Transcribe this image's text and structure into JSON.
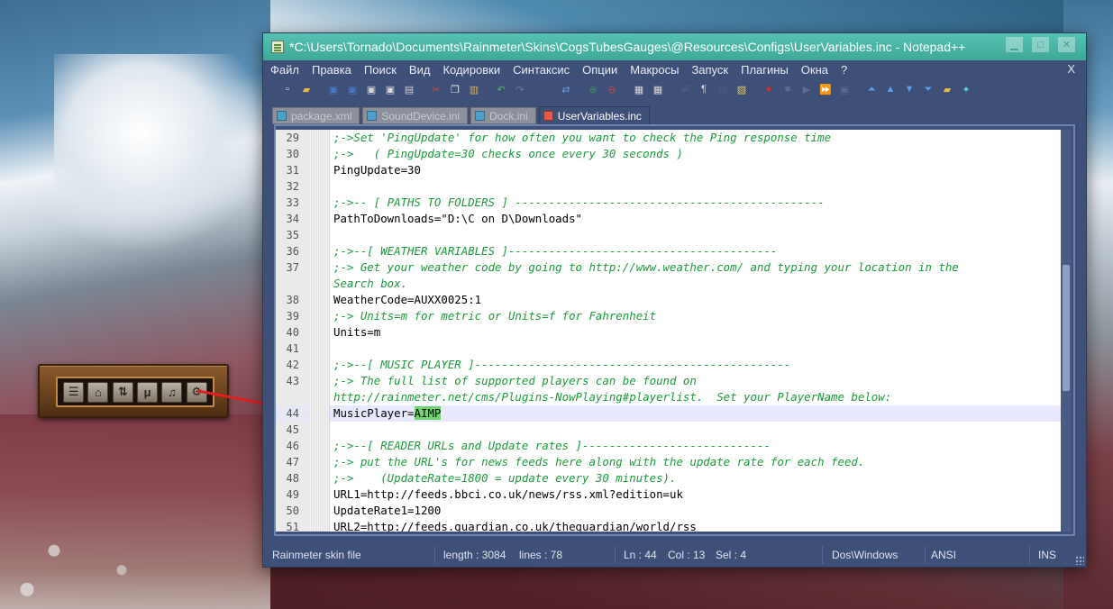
{
  "window": {
    "title": "*C:\\Users\\Tornado\\Documents\\Rainmeter\\Skins\\CogsTubesGauges\\@Resources\\Configs\\UserVariables.inc - Notepad++",
    "minimize_label": "▁",
    "maximize_label": "□",
    "close_label": "✕"
  },
  "menu": {
    "items": [
      "Файл",
      "Правка",
      "Поиск",
      "Вид",
      "Кодировки",
      "Синтаксис",
      "Опции",
      "Макросы",
      "Запуск",
      "Плагины",
      "Окна",
      "?"
    ],
    "close_label": "X"
  },
  "toolbar": {
    "buttons": [
      {
        "name": "new-file-icon",
        "glyph": "▫",
        "color": "#f2f2f2"
      },
      {
        "name": "open-file-icon",
        "glyph": "▰",
        "color": "#e7b94a"
      },
      {
        "name": "save-icon",
        "glyph": "▣",
        "color": "#4a78c8"
      },
      {
        "name": "save-all-icon",
        "glyph": "▣",
        "color": "#4a78c8"
      },
      {
        "name": "close-file-icon",
        "glyph": "▣",
        "color": "#d8d8d8"
      },
      {
        "name": "close-all-icon",
        "glyph": "▣",
        "color": "#d8d8d8"
      },
      {
        "name": "print-icon",
        "glyph": "▤",
        "color": "#cfcfcf"
      },
      {
        "name": "cut-icon",
        "glyph": "✂",
        "color": "#d24a3a"
      },
      {
        "name": "copy-icon",
        "glyph": "❐",
        "color": "#e8e8e8"
      },
      {
        "name": "paste-icon",
        "glyph": "▥",
        "color": "#d8b060"
      },
      {
        "name": "undo-icon",
        "glyph": "↶",
        "color": "#4ab86a"
      },
      {
        "name": "redo-icon",
        "glyph": "↷",
        "color": "#6a7a9a"
      },
      {
        "name": "find-icon",
        "glyph": "⌕",
        "color": "#3e4f78"
      },
      {
        "name": "replace-icon",
        "glyph": "⇄",
        "color": "#6aa0e0"
      },
      {
        "name": "zoom-in-icon",
        "glyph": "⊕",
        "color": "#3e8e5a"
      },
      {
        "name": "zoom-out-icon",
        "glyph": "⊖",
        "color": "#c84a4a"
      },
      {
        "name": "sync-vertical-icon",
        "glyph": "▦",
        "color": "#d8d8d8"
      },
      {
        "name": "sync-horizontal-icon",
        "glyph": "▦",
        "color": "#d8d8d8"
      },
      {
        "name": "word-wrap-icon",
        "glyph": "⏎",
        "color": "#5a6a90"
      },
      {
        "name": "show-all-chars-icon",
        "glyph": "¶",
        "color": "#cfd6e8"
      },
      {
        "name": "indent-guide-icon",
        "glyph": "▤",
        "color": "#4a5a80"
      },
      {
        "name": "doc-map-icon",
        "glyph": "▧",
        "color": "#e7c85a"
      },
      {
        "name": "record-macro-icon",
        "glyph": "●",
        "color": "#d82a2a"
      },
      {
        "name": "stop-macro-icon",
        "glyph": "■",
        "color": "#5a6a90"
      },
      {
        "name": "play-macro-icon",
        "glyph": "▶",
        "color": "#5a6a90"
      },
      {
        "name": "run-macro-multiple-icon",
        "glyph": "⏩",
        "color": "#5a7ad8"
      },
      {
        "name": "save-macro-icon",
        "glyph": "▣",
        "color": "#5a6a90"
      },
      {
        "name": "move-top-icon",
        "glyph": "⏶",
        "color": "#5aa0e8"
      },
      {
        "name": "move-up-icon",
        "glyph": "▲",
        "color": "#5aa0e8"
      },
      {
        "name": "move-down-icon",
        "glyph": "▼",
        "color": "#5aa0e8"
      },
      {
        "name": "move-bottom-icon",
        "glyph": "⏷",
        "color": "#5aa0e8"
      },
      {
        "name": "folder-icon",
        "glyph": "▰",
        "color": "#e7b94a"
      },
      {
        "name": "plugin-icon",
        "glyph": "✦",
        "color": "#5ad0c8"
      }
    ]
  },
  "tabs": [
    {
      "label": "package.xml",
      "active": false
    },
    {
      "label": "SoundDevice.ini",
      "active": false
    },
    {
      "label": "Dock.ini",
      "active": false
    },
    {
      "label": "UserVariables.inc",
      "active": true
    }
  ],
  "editor": {
    "lines": [
      {
        "num": "29",
        "text": ";->Set 'PingUpdate' for how often you want to check the Ping response time",
        "comment": true
      },
      {
        "num": "30",
        "text": ";->   ( PingUpdate=30 checks once every 30 seconds )",
        "comment": true
      },
      {
        "num": "31",
        "text": "PingUpdate=30",
        "comment": false
      },
      {
        "num": "32",
        "text": "",
        "comment": false
      },
      {
        "num": "33",
        "text": ";->-- [ PATHS TO FOLDERS ] ----------------------------------------------",
        "comment": true
      },
      {
        "num": "34",
        "text": "PathToDownloads=\"D:\\C on D\\Downloads\"",
        "comment": false
      },
      {
        "num": "35",
        "text": "",
        "comment": false
      },
      {
        "num": "36",
        "text": ";->--[ WEATHER VARIABLES ]----------------------------------------",
        "comment": true
      },
      {
        "num": "37",
        "text": ";-> Get your weather code by going to http://www.weather.com/ and typing your location in the",
        "comment": true
      },
      {
        "num": "",
        "text": "Search box.",
        "comment": true
      },
      {
        "num": "38",
        "text": "WeatherCode=AUXX0025:1",
        "comment": false
      },
      {
        "num": "39",
        "text": ";-> Units=m for metric or Units=f for Fahrenheit",
        "comment": true
      },
      {
        "num": "40",
        "text": "Units=m",
        "comment": false
      },
      {
        "num": "41",
        "text": "",
        "comment": false
      },
      {
        "num": "42",
        "text": ";->--[ MUSIC PLAYER ]-----------------------------------------------",
        "comment": true
      },
      {
        "num": "43",
        "text": ";-> The full list of supported players can be found on",
        "comment": true
      },
      {
        "num": "",
        "text": "http://rainmeter.net/cms/Plugins-NowPlaying#playerlist.  Set your PlayerName below:",
        "comment": true
      },
      {
        "num": "44",
        "text": "MusicPlayer=",
        "comment": false,
        "current": true,
        "selected": "AIMP"
      },
      {
        "num": "45",
        "text": "",
        "comment": false
      },
      {
        "num": "46",
        "text": ";->--[ READER URLs and Update rates ]----------------------------",
        "comment": true
      },
      {
        "num": "47",
        "text": ";-> put the URL's for news feeds here along with the update rate for each feed.",
        "comment": true
      },
      {
        "num": "48",
        "text": ";->    (UpdateRate=1800 = update every 30 minutes).",
        "comment": true
      },
      {
        "num": "49",
        "text": "URL1=http://feeds.bbci.co.uk/news/rss.xml?edition=uk",
        "comment": false
      },
      {
        "num": "50",
        "text": "UpdateRate1=1200",
        "comment": false
      },
      {
        "num": "51",
        "text": "URL2=http://feeds.guardian.co.uk/theguardian/world/rss",
        "comment": false
      }
    ]
  },
  "status": {
    "file_type": "Rainmeter skin file",
    "length": "length : 3084",
    "lines": "lines : 78",
    "ln": "Ln : 44",
    "col": "Col : 13",
    "sel": "Sel : 4",
    "eol": "Dos\\Windows",
    "encoding": "ANSI",
    "mode": "INS"
  },
  "widget": {
    "buttons": [
      {
        "name": "rss-icon",
        "glyph": "☰"
      },
      {
        "name": "network-icon",
        "glyph": "⌂"
      },
      {
        "name": "dock-settings-icon",
        "glyph": "⇅"
      },
      {
        "name": "text-icon",
        "glyph": "μ"
      },
      {
        "name": "music-icon",
        "glyph": "♫"
      },
      {
        "name": "gear-icon",
        "glyph": "⚙"
      }
    ]
  },
  "colors": {
    "titlebar": "#4fb8a9",
    "window_bg": "#3e4f78",
    "comment_text": "#1a9a3a",
    "selection": "#6fd36f",
    "arrow": "#e02020"
  }
}
